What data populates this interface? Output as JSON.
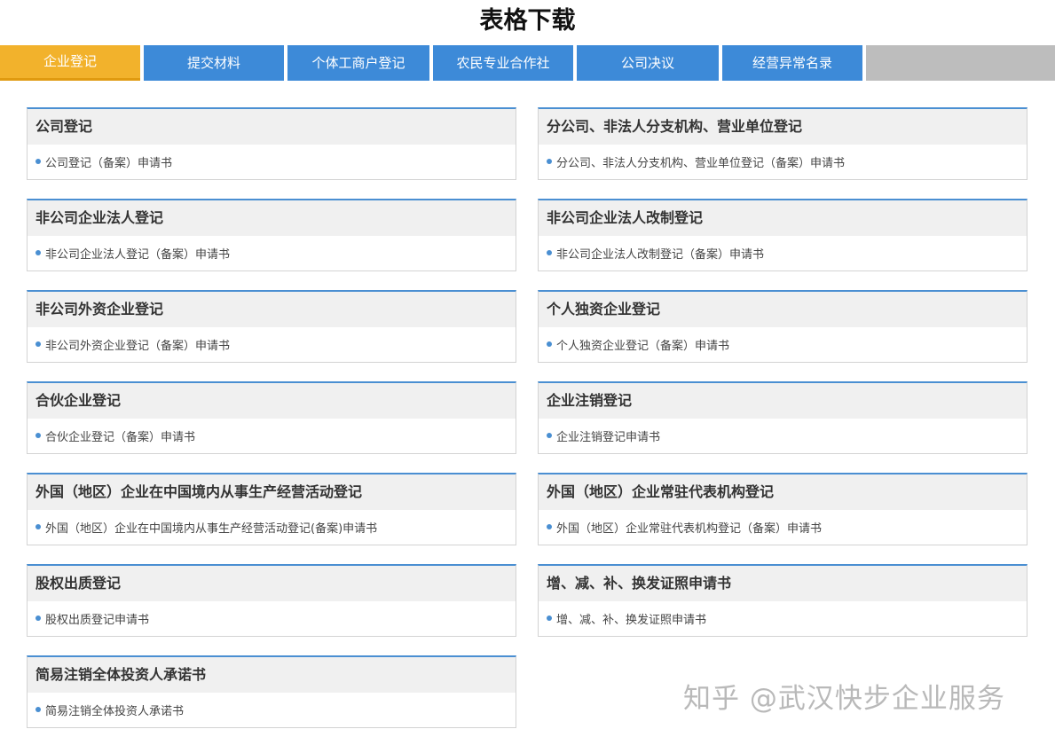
{
  "page": {
    "title": "表格下载"
  },
  "tabs": [
    {
      "label": "企业登记",
      "state": "active"
    },
    {
      "label": "提交材料",
      "state": "normal"
    },
    {
      "label": "个体工商户登记",
      "state": "normal"
    },
    {
      "label": "农民专业合作社",
      "state": "normal"
    },
    {
      "label": "公司决议",
      "state": "normal"
    },
    {
      "label": "经营异常名录",
      "state": "normal"
    }
  ],
  "cards": [
    {
      "title": "公司登记",
      "link": "公司登记（备案）申请书"
    },
    {
      "title": "分公司、非法人分支机构、营业单位登记",
      "link": "分公司、非法人分支机构、营业单位登记（备案）申请书"
    },
    {
      "title": "非公司企业法人登记",
      "link": "非公司企业法人登记（备案）申请书"
    },
    {
      "title": "非公司企业法人改制登记",
      "link": "非公司企业法人改制登记（备案）申请书"
    },
    {
      "title": "非公司外资企业登记",
      "link": "非公司外资企业登记（备案）申请书"
    },
    {
      "title": "个人独资企业登记",
      "link": "个人独资企业登记（备案）申请书"
    },
    {
      "title": "合伙企业登记",
      "link": "合伙企业登记（备案）申请书"
    },
    {
      "title": "企业注销登记",
      "link": "企业注销登记申请书"
    },
    {
      "title": "外国（地区）企业在中国境内从事生产经营活动登记",
      "link": "外国（地区）企业在中国境内从事生产经营活动登记(备案)申请书"
    },
    {
      "title": "外国（地区）企业常驻代表机构登记",
      "link": "外国（地区）企业常驻代表机构登记（备案）申请书"
    },
    {
      "title": "股权出质登记",
      "link": "股权出质登记申请书"
    },
    {
      "title": "增、减、补、换发证照申请书",
      "link": "增、减、补、换发证照申请书"
    },
    {
      "title": "简易注销全体投资人承诺书",
      "link": "简易注销全体投资人承诺书"
    }
  ],
  "watermark": {
    "text": "知乎 @武汉快步企业服务"
  },
  "colors": {
    "tab_active": "#f2b22c",
    "tab_normal": "#3d8ad8",
    "tab_filler": "#bdbdbd",
    "card_accent": "#4a8fd2",
    "card_header_bg": "#f0f0f0"
  }
}
